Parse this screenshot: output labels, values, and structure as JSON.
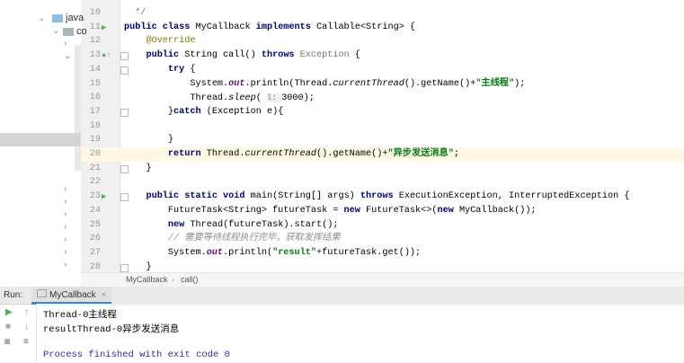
{
  "tree": {
    "items": [
      {
        "label": "java"
      },
      {
        "label": "co"
      }
    ]
  },
  "editor": {
    "lines": [
      {
        "n": "10",
        "tokens": [
          [
            "  */",
            "gray"
          ]
        ]
      },
      {
        "n": "11",
        "run": true,
        "tokens": [
          [
            "public class ",
            "kw"
          ],
          [
            "MyCallback ",
            ""
          ],
          [
            "implements ",
            "kw"
          ],
          [
            "Callable<String> {",
            ""
          ]
        ]
      },
      {
        "n": "12",
        "tokens": [
          [
            "    ",
            ""
          ],
          [
            "@Override",
            "ann"
          ]
        ]
      },
      {
        "n": "13",
        "tokens": [
          [
            "    ",
            ""
          ],
          [
            "public ",
            "kw"
          ],
          [
            "String call() ",
            ""
          ],
          [
            "throws ",
            "kw"
          ],
          [
            "Exception",
            "gray"
          ],
          [
            " {",
            ""
          ]
        ]
      },
      {
        "n": "14",
        "tokens": [
          [
            "        ",
            ""
          ],
          [
            "try ",
            "kw"
          ],
          [
            "{",
            ""
          ]
        ]
      },
      {
        "n": "15",
        "tokens": [
          [
            "            System.",
            ""
          ],
          [
            "out",
            "it"
          ],
          [
            ".println(Thread.",
            ""
          ],
          [
            "currentThread",
            "sit"
          ],
          [
            "().getName()+",
            ""
          ],
          [
            "\"主线程\"",
            "str"
          ],
          [
            ");",
            ""
          ]
        ]
      },
      {
        "n": "16",
        "tokens": [
          [
            "            Thread.",
            ""
          ],
          [
            "sleep",
            "sit"
          ],
          [
            "( ",
            ""
          ],
          [
            "l: ",
            "hint"
          ],
          [
            "3000);",
            ""
          ]
        ]
      },
      {
        "n": "17",
        "tokens": [
          [
            "        }",
            ""
          ],
          [
            "catch ",
            "kw"
          ],
          [
            "(Exception e){",
            ""
          ]
        ]
      },
      {
        "n": "18",
        "tokens": []
      },
      {
        "n": "19",
        "tokens": [
          [
            "        }",
            ""
          ]
        ]
      },
      {
        "n": "20",
        "hl": true,
        "tokens": [
          [
            "        ",
            ""
          ],
          [
            "return ",
            "kw"
          ],
          [
            "Thread.",
            ""
          ],
          [
            "currentThread",
            "sit"
          ],
          [
            "().getName()+",
            ""
          ],
          [
            "\"异步发送消息\"",
            "str"
          ],
          [
            ";",
            ""
          ]
        ]
      },
      {
        "n": "21",
        "tokens": [
          [
            "    }",
            ""
          ]
        ]
      },
      {
        "n": "22",
        "tokens": []
      },
      {
        "n": "23",
        "run": true,
        "tokens": [
          [
            "    ",
            ""
          ],
          [
            "public static void ",
            "kw"
          ],
          [
            "main(String[] args) ",
            ""
          ],
          [
            "throws ",
            "kw"
          ],
          [
            "ExecutionException, InterruptedException {",
            ""
          ]
        ]
      },
      {
        "n": "24",
        "tokens": [
          [
            "        FutureTask<String> futureTask = ",
            ""
          ],
          [
            "new ",
            "kw"
          ],
          [
            "FutureTask<>(",
            ""
          ],
          [
            "new ",
            "kw"
          ],
          [
            "MyCallback());",
            ""
          ]
        ]
      },
      {
        "n": "25",
        "tokens": [
          [
            "        ",
            ""
          ],
          [
            "new ",
            "kw"
          ],
          [
            "Thread(futureTask).start();",
            ""
          ]
        ]
      },
      {
        "n": "26",
        "tokens": [
          [
            "        ",
            ""
          ],
          [
            "// 需要等待线程执行完毕，获取发挥结果",
            "cm"
          ]
        ]
      },
      {
        "n": "27",
        "tokens": [
          [
            "        System.",
            ""
          ],
          [
            "out",
            "it"
          ],
          [
            ".println(",
            ""
          ],
          [
            "\"result\"",
            "str"
          ],
          [
            "+futureTask.get());",
            ""
          ]
        ]
      },
      {
        "n": "28",
        "tokens": [
          [
            "    }",
            ""
          ]
        ]
      }
    ]
  },
  "breadcrumb": {
    "class": "MyCallback",
    "sep": "›",
    "method": "call()"
  },
  "run": {
    "label": "Run:",
    "tab": "MyCallback",
    "close": "×"
  },
  "console": {
    "lines": [
      "Thread-0主线程",
      "resultThread-0异步发送消息",
      "",
      "Process finished with exit code 0"
    ]
  }
}
